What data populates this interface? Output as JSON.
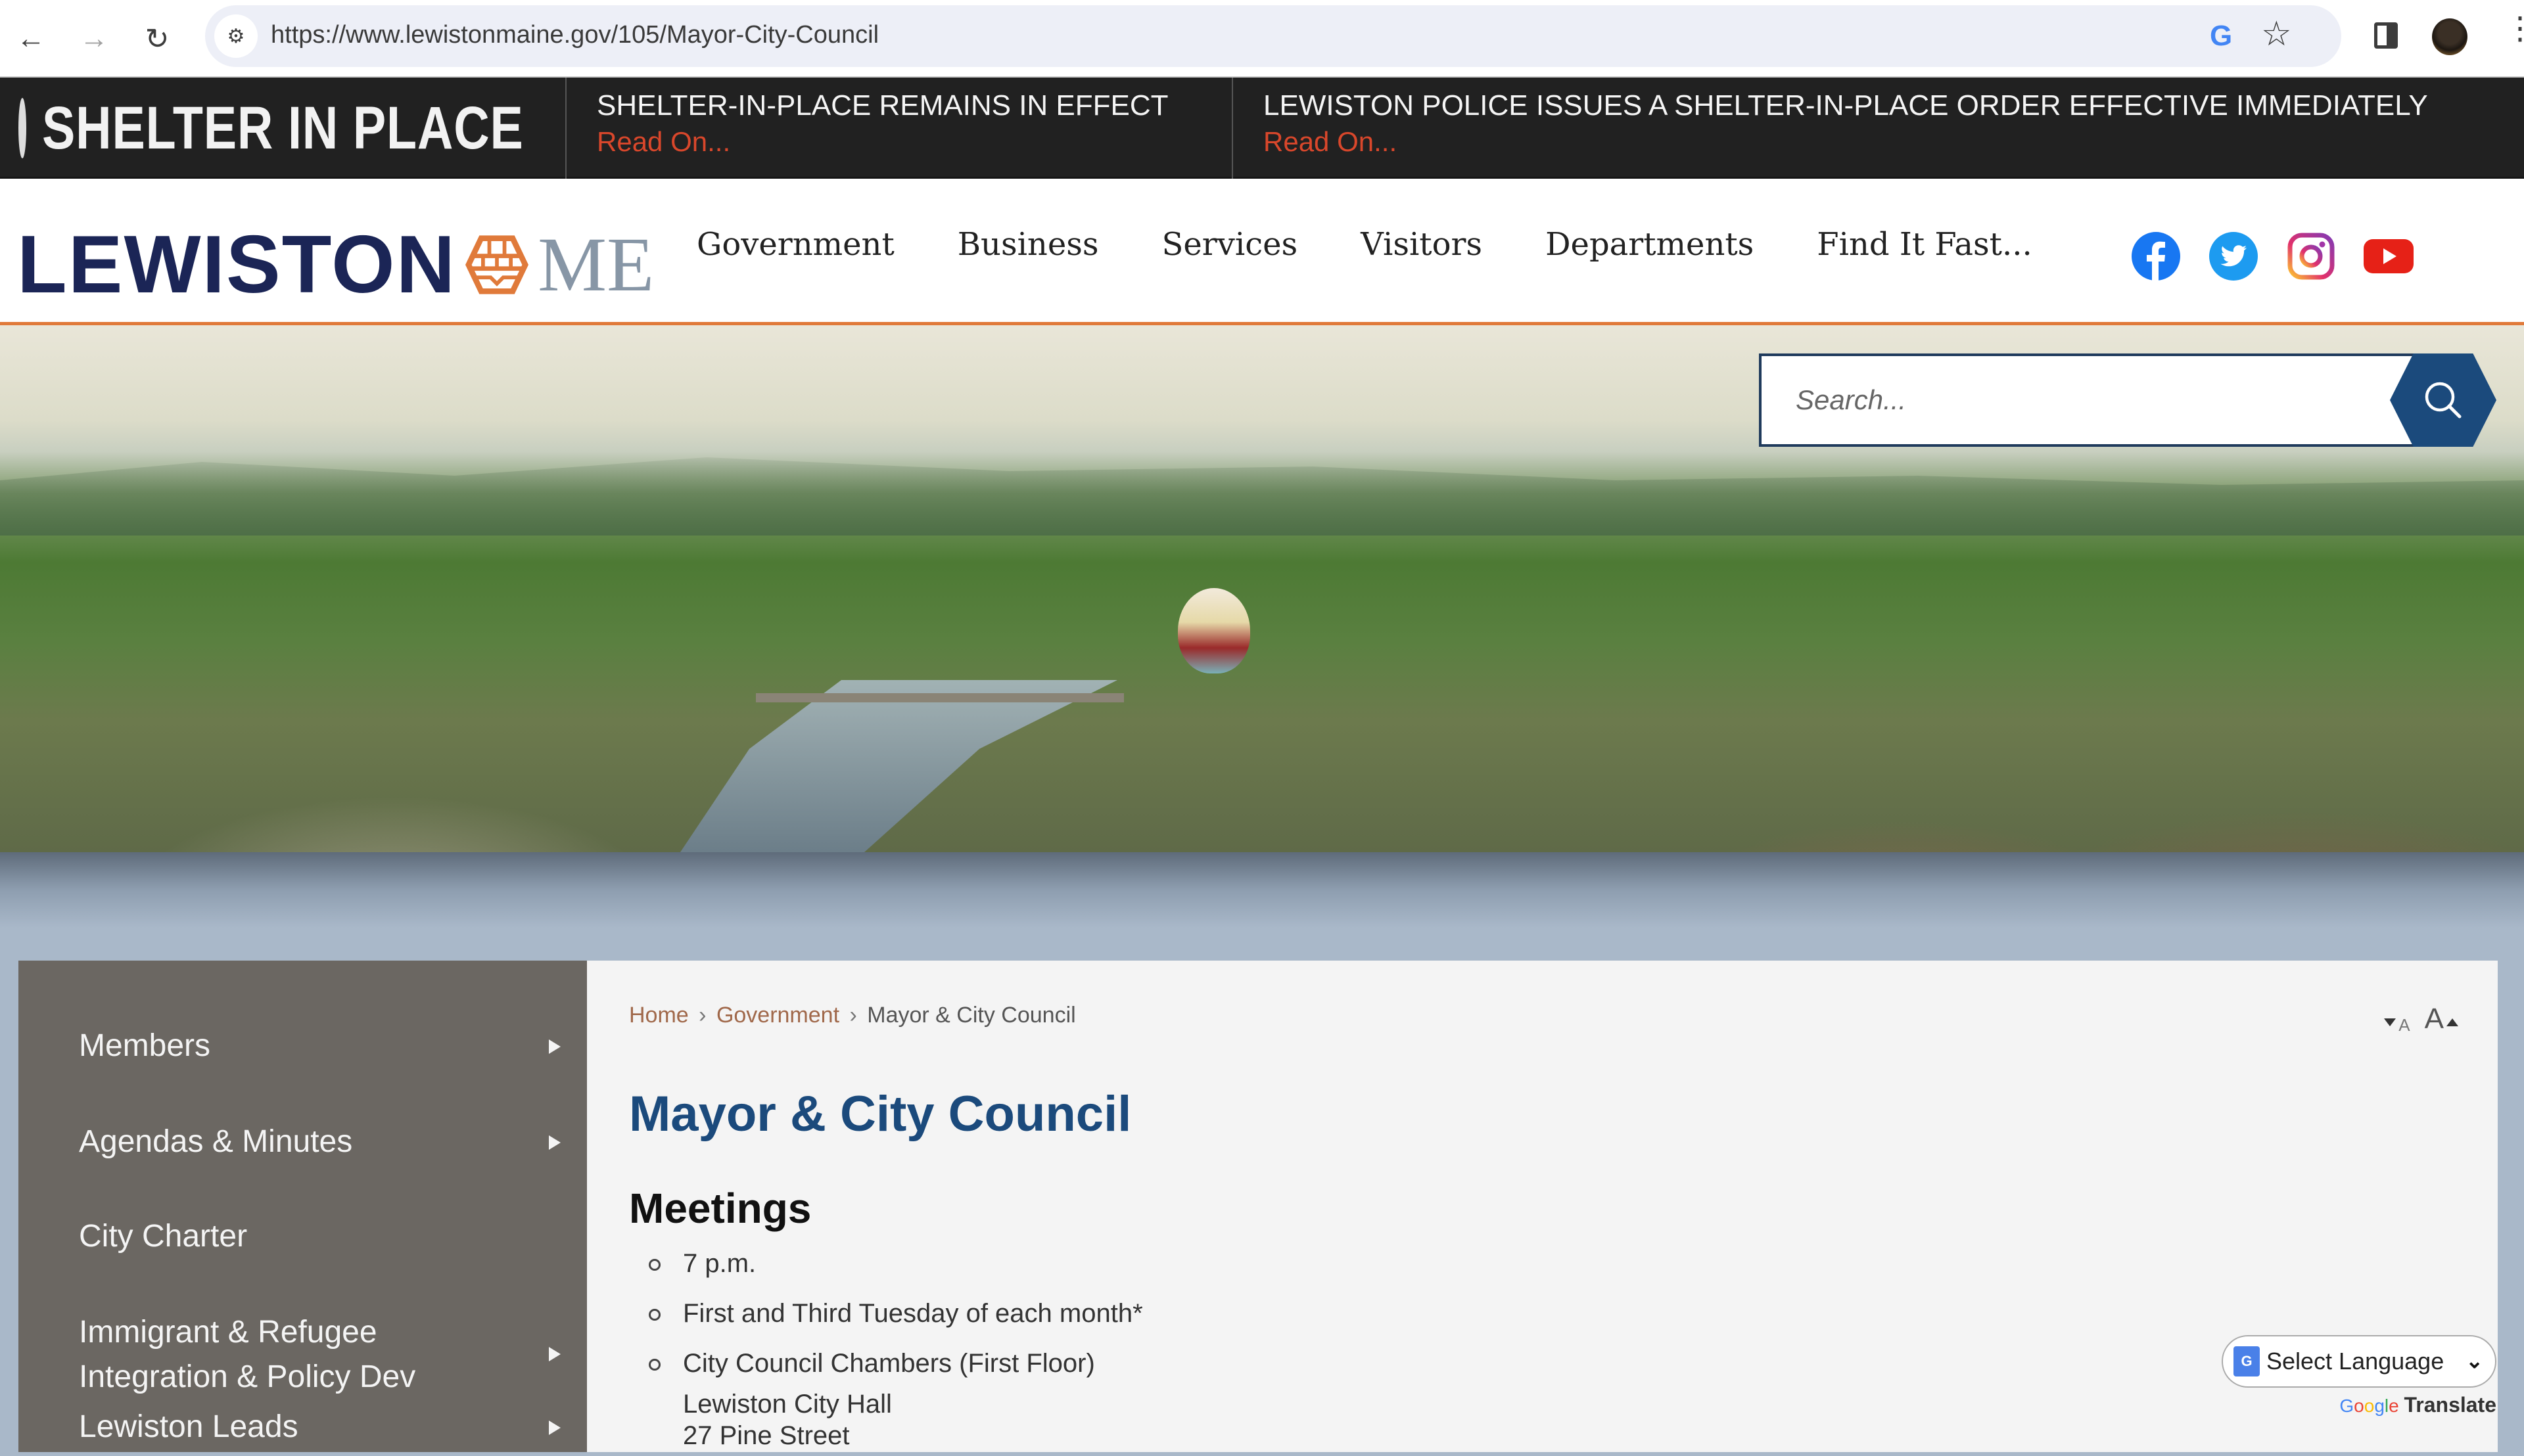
{
  "browser": {
    "url": "https://www.lewistonmaine.gov/105/Mayor-City-Council",
    "back_icon": "←",
    "forward_icon": "→",
    "reload_icon": "↻",
    "site_info_icon": "⚙",
    "google_icon": "G",
    "bookmark_icon": "☆",
    "menu_icon": "⋮"
  },
  "alert": {
    "title": "SHELTER IN PLACE",
    "items": [
      {
        "headline": "SHELTER-IN-PLACE REMAINS IN EFFECT",
        "link": "Read On..."
      },
      {
        "headline": "LEWISTON POLICE ISSUES A SHELTER-IN-PLACE ORDER EFFECTIVE IMMEDIATELY",
        "link": "Read On..."
      }
    ]
  },
  "header": {
    "logo_word": "LEWISTON",
    "logo_state": "ME",
    "nav": [
      "Government",
      "Business",
      "Services",
      "Visitors",
      "Departments",
      "Find It Fast..."
    ],
    "social": [
      "facebook",
      "twitter",
      "instagram",
      "youtube"
    ]
  },
  "search": {
    "placeholder": "Search..."
  },
  "sidebar": {
    "items": [
      {
        "label": "Members",
        "has_submenu": true
      },
      {
        "label": "Agendas & Minutes",
        "has_submenu": true
      },
      {
        "label": "City Charter",
        "has_submenu": false
      },
      {
        "label": "Immigrant & Refugee Integration & Policy Dev",
        "line1": "Immigrant & Refugee",
        "line2": "Integration & Policy Dev",
        "has_submenu": true
      },
      {
        "label": "Lewiston Leads",
        "has_submenu": true
      }
    ]
  },
  "content": {
    "breadcrumb": {
      "home": "Home",
      "sep": "›",
      "parent": "Government",
      "current": "Mayor & City Council"
    },
    "text_resize": {
      "smaller": "A",
      "larger": "A"
    },
    "title": "Mayor & City Council",
    "meetings": {
      "heading": "Meetings",
      "items": [
        "7 p.m.",
        "First and Third Tuesday of each month*",
        "City Council Chambers (First Floor)"
      ],
      "address_lines": [
        "Lewiston City Hall",
        "27 Pine Street"
      ]
    }
  },
  "translate": {
    "select_label": "Select Language",
    "chevron": "⌄",
    "powered_google": "Google",
    "powered_translate": "Translate"
  },
  "colors": {
    "alert_bg": "#212121",
    "alert_link": "#d9472b",
    "brand_navy": "#1b2556",
    "brand_orange": "#e07a3a",
    "title_blue": "#1b4a7c",
    "sidebar_bg": "#6b6762"
  }
}
